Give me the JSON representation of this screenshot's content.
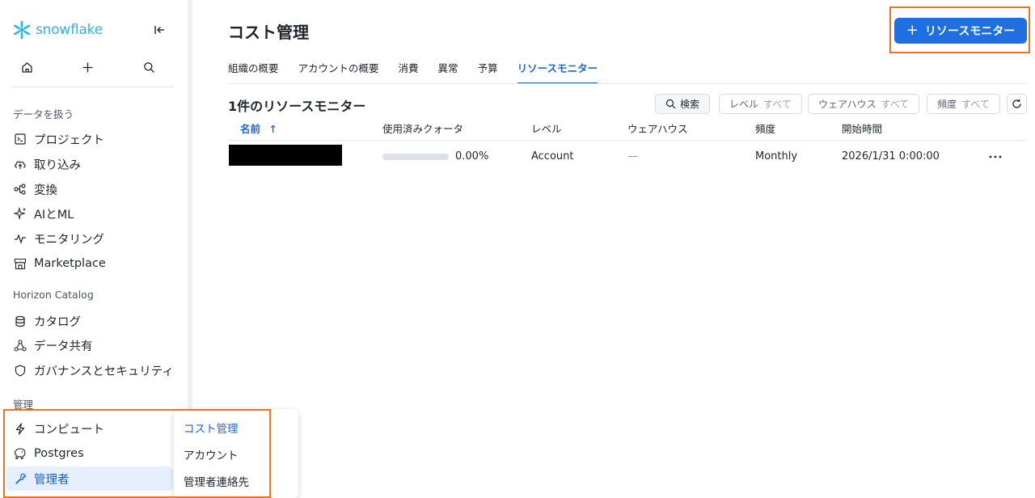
{
  "brand": {
    "name": "snowflake",
    "color": "#29b5e8",
    "logo_icon": "snowflake-logo-icon"
  },
  "sidebar": {
    "sections": [
      {
        "label": "データを扱う"
      },
      {
        "label": "Horizon Catalog"
      },
      {
        "label": "管理"
      }
    ],
    "items": [
      {
        "label": "プロジェクト",
        "icon": "terminal-icon"
      },
      {
        "label": "取り込み",
        "icon": "cloud-upload-icon"
      },
      {
        "label": "変換",
        "icon": "transform-icon"
      },
      {
        "label": "AIとML",
        "icon": "sparkle-icon"
      },
      {
        "label": "モニタリング",
        "icon": "activity-icon"
      },
      {
        "label": "Marketplace",
        "icon": "store-icon"
      },
      {
        "label": "カタログ",
        "icon": "database-icon"
      },
      {
        "label": "データ共有",
        "icon": "share-icon"
      },
      {
        "label": "ガバナンスとセキュリティ",
        "icon": "shield-icon"
      },
      {
        "label": "コンピュート",
        "icon": "lightning-icon"
      },
      {
        "label": "Postgres",
        "icon": "elephant-icon"
      },
      {
        "label": "管理者",
        "icon": "wrench-icon",
        "active": true
      }
    ]
  },
  "submenu": {
    "items": [
      {
        "label": "コスト管理",
        "active": true
      },
      {
        "label": "アカウント"
      },
      {
        "label": "管理者連絡先"
      }
    ]
  },
  "page": {
    "title": "コスト管理",
    "primary_button": "リソースモニター",
    "tabs": [
      {
        "label": "組織の概要"
      },
      {
        "label": "アカウントの概要"
      },
      {
        "label": "消費"
      },
      {
        "label": "異常"
      },
      {
        "label": "予算"
      },
      {
        "label": "リソースモニター",
        "active": true
      }
    ],
    "count_title": "1件のリソースモニター",
    "filters": {
      "search": "検索",
      "level_label": "レベル",
      "level_value": "すべて",
      "warehouse_label": "ウェアハウス",
      "warehouse_value": "すべて",
      "frequency_label": "頻度",
      "frequency_value": "すべて"
    },
    "table": {
      "columns": [
        "名前",
        "使用済みクォータ",
        "レベル",
        "ウェアハウス",
        "頻度",
        "開始時間"
      ],
      "sort_indicator": "↑",
      "rows": [
        {
          "name": "",
          "quota_percent": 0,
          "quota_text": "0.00%",
          "level": "Account",
          "warehouse": "—",
          "frequency": "Monthly",
          "start_time": "2026/1/31 0:00:00"
        }
      ]
    }
  },
  "colors": {
    "accent": "#1f6fe0",
    "highlight_border": "#f07323",
    "active_bg": "#e5efff"
  }
}
